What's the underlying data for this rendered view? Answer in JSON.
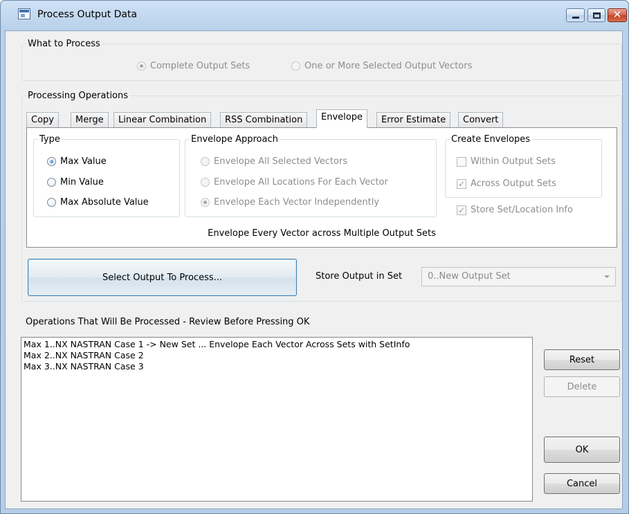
{
  "window": {
    "title": "Process Output Data"
  },
  "what_to_process": {
    "legend": "What to Process",
    "options": [
      {
        "label": "Complete Output Sets",
        "selected": true
      },
      {
        "label": "One or More Selected Output Vectors",
        "selected": false
      }
    ]
  },
  "operations": {
    "legend": "Processing Operations",
    "tabs": [
      {
        "label": "Copy"
      },
      {
        "label": "Merge"
      },
      {
        "label": "Linear Combination"
      },
      {
        "label": "RSS Combination"
      },
      {
        "label": "Envelope",
        "active": true
      },
      {
        "label": "Error Estimate"
      },
      {
        "label": "Convert"
      }
    ],
    "type": {
      "legend": "Type",
      "options": [
        {
          "label": "Max Value",
          "selected": true
        },
        {
          "label": "Min Value",
          "selected": false
        },
        {
          "label": "Max Absolute Value",
          "selected": false
        }
      ]
    },
    "approach": {
      "legend": "Envelope Approach",
      "options": [
        {
          "label": "Envelope All Selected Vectors",
          "selected": false
        },
        {
          "label": "Envelope All Locations For Each Vector",
          "selected": false
        },
        {
          "label": "Envelope Each Vector Independently",
          "selected": true
        }
      ]
    },
    "create": {
      "legend": "Create Envelopes",
      "options": [
        {
          "label": "Within Output Sets",
          "checked": false
        },
        {
          "label": "Across Output Sets",
          "checked": true
        }
      ]
    },
    "store_info": {
      "label": "Store Set/Location Info",
      "checked": true
    },
    "description": "Envelope Every Vector across Multiple Output Sets"
  },
  "select_button": "Select Output To Process...",
  "store_output": {
    "label": "Store Output in Set",
    "value": "0..New Output Set"
  },
  "review": {
    "label": "Operations That Will Be Processed - Review Before Pressing OK",
    "items": [
      "Max 1..NX NASTRAN Case 1 -> New Set ... Envelope Each Vector Across Sets with SetInfo",
      "Max 2..NX NASTRAN Case 2",
      "Max 3..NX NASTRAN Case 3"
    ]
  },
  "buttons": {
    "reset": "Reset",
    "delete": "Delete",
    "ok": "OK",
    "cancel": "Cancel"
  }
}
